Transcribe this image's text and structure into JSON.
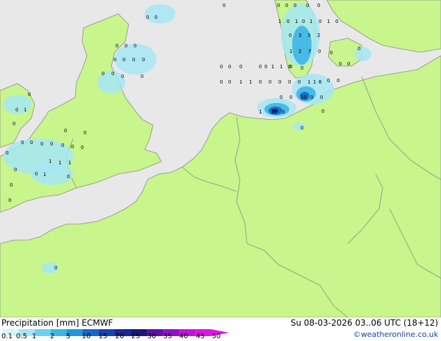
{
  "title": "Precipitation [mm]  ECMWF",
  "valid_time": "Su 08-03-2026 03..06 UTC (18+12)",
  "credit": "©weatheronline.co.uk",
  "colors": {
    "sea": "#e8e8e8",
    "land": "#c8f58c",
    "border": "#8a8a8a"
  },
  "legend": {
    "labels": [
      "0.1",
      "0.5",
      "1",
      "2",
      "5",
      "10",
      "15",
      "20",
      "25",
      "30",
      "35",
      "40",
      "45",
      "50"
    ],
    "colors": [
      "#d4f4fa",
      "#a5e6f5",
      "#6fd1ee",
      "#3cb6e4",
      "#2196db",
      "#1766c9",
      "#1743b0",
      "#1a2894",
      "#1a167a",
      "#5e12a6",
      "#8e12c6",
      "#c014d8",
      "#e014e0"
    ]
  },
  "values": [
    {
      "t": "0"
    },
    {
      "t": "0"
    },
    {
      "t": "0"
    },
    {
      "t": "0"
    },
    {
      "t": "0"
    },
    {
      "t": "0"
    },
    {
      "t": "0"
    },
    {
      "t": "0"
    },
    {
      "t": "1"
    },
    {
      "t": "0"
    },
    {
      "t": "1"
    },
    {
      "t": "0"
    },
    {
      "t": "1"
    },
    {
      "t": "0"
    },
    {
      "t": "1"
    },
    {
      "t": "0"
    },
    {
      "t": "0"
    },
    {
      "t": "3"
    },
    {
      "t": "3"
    },
    {
      "t": "2"
    },
    {
      "t": "1"
    },
    {
      "t": "2"
    },
    {
      "t": "7"
    },
    {
      "t": "0"
    },
    {
      "t": "0"
    },
    {
      "t": "0"
    },
    {
      "t": "0"
    },
    {
      "t": "0"
    },
    {
      "t": "0"
    },
    {
      "t": "0"
    },
    {
      "t": "0"
    },
    {
      "t": "1"
    },
    {
      "t": "1"
    },
    {
      "t": "0"
    },
    {
      "t": "0"
    },
    {
      "t": "0"
    },
    {
      "t": "0"
    },
    {
      "t": "0"
    },
    {
      "t": "0"
    },
    {
      "t": "0"
    },
    {
      "t": "0"
    },
    {
      "t": "0"
    },
    {
      "t": "1"
    },
    {
      "t": "1"
    },
    {
      "t": "0"
    },
    {
      "t": "0"
    },
    {
      "t": "0"
    },
    {
      "t": "0"
    },
    {
      "t": "1"
    },
    {
      "t": "1"
    },
    {
      "t": "6"
    },
    {
      "t": "0"
    },
    {
      "t": "0"
    },
    {
      "t": "0"
    },
    {
      "t": "10"
    },
    {
      "t": "0"
    },
    {
      "t": "0"
    },
    {
      "t": "1"
    },
    {
      "t": "20"
    },
    {
      "t": "3"
    },
    {
      "t": "0"
    },
    {
      "t": "0"
    },
    {
      "t": "0"
    },
    {
      "t": "0"
    },
    {
      "t": "0"
    },
    {
      "t": "0"
    },
    {
      "t": "0"
    },
    {
      "t": "0"
    },
    {
      "t": "0"
    },
    {
      "t": "0"
    },
    {
      "t": "0"
    },
    {
      "t": "0"
    },
    {
      "t": "0"
    },
    {
      "t": "0"
    },
    {
      "t": "0"
    },
    {
      "t": "1"
    },
    {
      "t": "0"
    },
    {
      "t": "0"
    },
    {
      "t": "0"
    },
    {
      "t": "0"
    },
    {
      "t": "0"
    },
    {
      "t": "0"
    },
    {
      "t": "0"
    },
    {
      "t": "0"
    },
    {
      "t": "0"
    },
    {
      "t": "0"
    },
    {
      "t": "1"
    },
    {
      "t": "1"
    },
    {
      "t": "1"
    },
    {
      "t": "0"
    },
    {
      "t": "1"
    },
    {
      "t": "0"
    },
    {
      "t": "0"
    },
    {
      "t": "0"
    },
    {
      "t": "0"
    },
    {
      "t": "0"
    },
    {
      "t": "0"
    }
  ]
}
